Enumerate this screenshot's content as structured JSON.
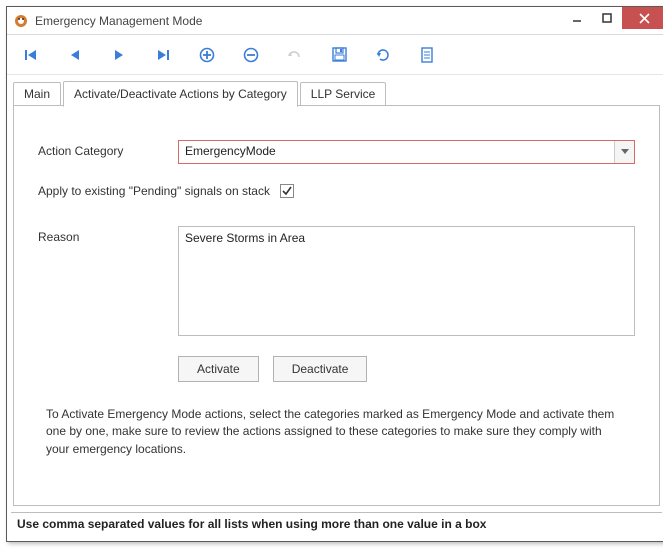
{
  "window": {
    "title": "Emergency Management Mode"
  },
  "tabs": {
    "main": "Main",
    "activate": "Activate/Deactivate Actions by Category",
    "llp": "LLP Service"
  },
  "form": {
    "action_category_label": "Action Category",
    "action_category_value": "EmergencyMode",
    "pending_label": "Apply to existing \"Pending\" signals on stack",
    "reason_label": "Reason",
    "reason_value": "Severe Storms in Area",
    "activate_btn": "Activate",
    "deactivate_btn": "Deactivate",
    "instructions": "To Activate Emergency Mode actions, select the categories marked as Emergency Mode and activate them one by one, make sure to review the actions assigned to these categories to make sure they comply with your emergency locations."
  },
  "status": "Use comma separated values for all lists when using more than one value in a box"
}
